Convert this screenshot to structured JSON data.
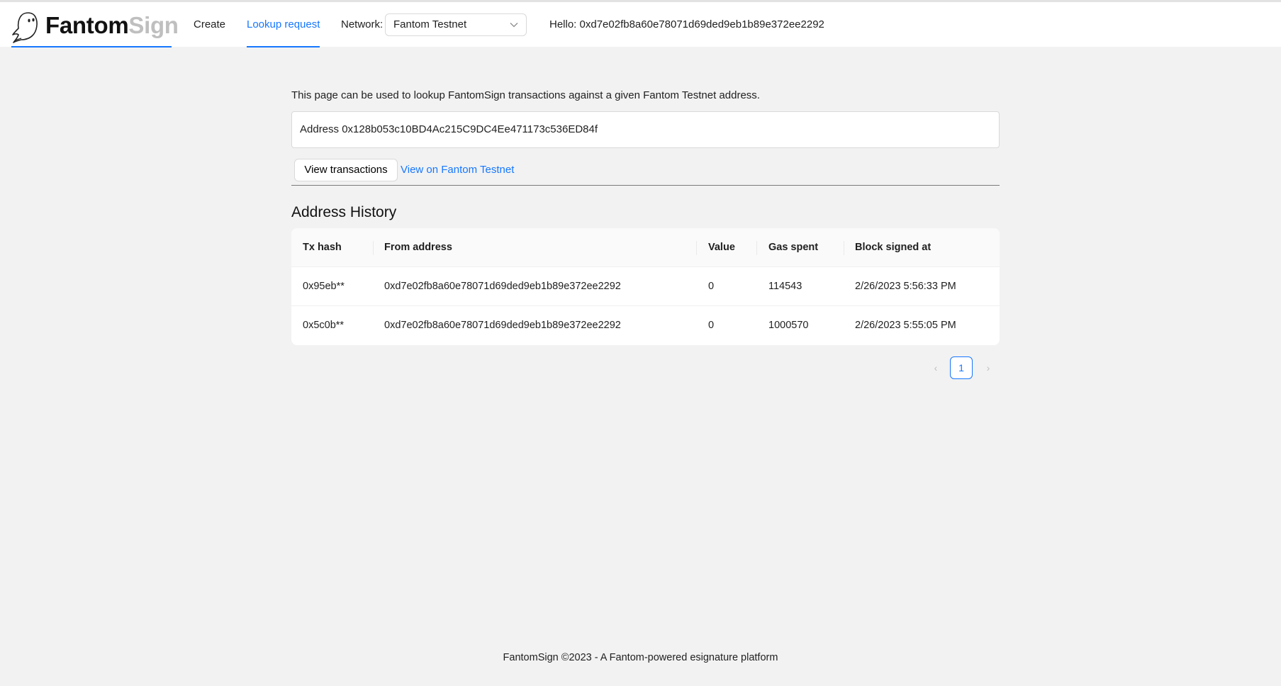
{
  "brand": {
    "name_part1": "Fantom",
    "name_part2": "Sign"
  },
  "nav": {
    "items": [
      {
        "label": "Create"
      },
      {
        "label": "Lookup request"
      }
    ],
    "network_label": "Network:",
    "network_value": "Fantom Testnet",
    "hello": "Hello: 0xd7e02fb8a60e78071d69ded9eb1b89e372ee2292"
  },
  "page": {
    "intro": "This page can be used to lookup FantomSign transactions against a given Fantom Testnet address.",
    "address_field": "Address 0x128b053c10BD4Ac215C9DC4Ee471173c536ED84f",
    "view_button": "View transactions",
    "view_link": "View on Fantom Testnet",
    "section_title": "Address History"
  },
  "table": {
    "headers": [
      "Tx hash",
      "From address",
      "Value",
      "Gas spent",
      "Block signed at"
    ],
    "rows": [
      [
        "0x95eb**",
        "0xd7e02fb8a60e78071d69ded9eb1b89e372ee2292",
        "0",
        "114543",
        "2/26/2023 5:56:33 PM"
      ],
      [
        "0x5c0b**",
        "0xd7e02fb8a60e78071d69ded9eb1b89e372ee2292",
        "0",
        "1000570",
        "2/26/2023 5:55:05 PM"
      ]
    ]
  },
  "pagination": {
    "current": "1",
    "prev_icon": "chevron-left-icon",
    "next_icon": "chevron-right-icon"
  },
  "footer": "FantomSign ©2023 - A Fantom-powered esignature platform",
  "colors": {
    "accent": "#1677ff",
    "background": "#f2f2f2"
  }
}
